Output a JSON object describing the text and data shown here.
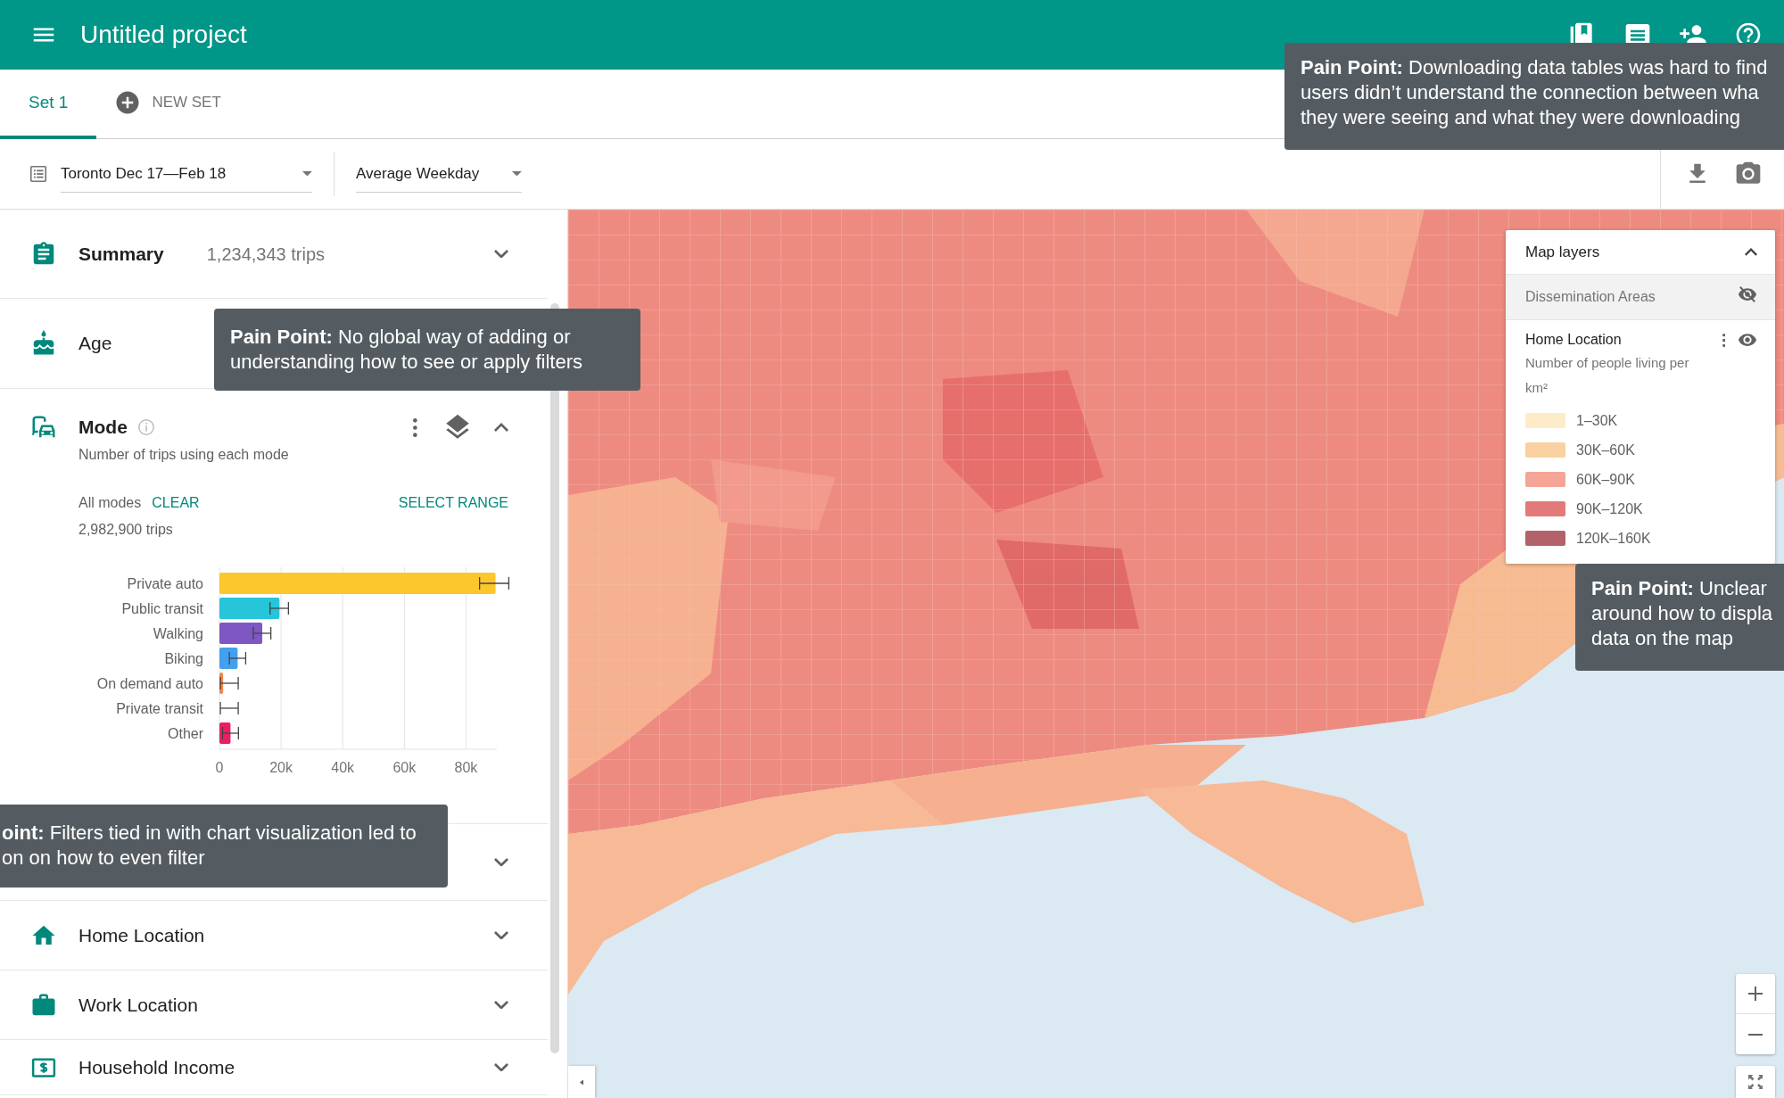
{
  "header": {
    "title": "Untitled project"
  },
  "tabs": [
    {
      "label": "Set 1",
      "selected": true,
      "kind": "tab"
    },
    {
      "label": "NEW SET",
      "selected": false,
      "kind": "add"
    }
  ],
  "filters": [
    {
      "label": "Toronto Dec 17—Feb 18",
      "kind": "dataset"
    },
    {
      "label": "Average Weekday",
      "kind": "plain"
    }
  ],
  "sections": [
    {
      "kind": "summary",
      "title": "Summary",
      "value": "1,234,343 trips",
      "expanded": false
    },
    {
      "kind": "plain",
      "title": "Age"
    },
    {
      "kind": "chart",
      "title": "Mode",
      "subtitle": "Number of trips using each mode",
      "filter_label": "All modes",
      "clear": "CLEAR",
      "select_range": "SELECT RANGE",
      "total": "2,982,900 trips",
      "expanded": true,
      "chart_data": {
        "type": "bar",
        "orientation": "horizontal",
        "categories": [
          "Private auto",
          "Public transit",
          "Walking",
          "Biking",
          "On demand auto",
          "Private transit",
          "Other"
        ],
        "values": [
          89600,
          19500,
          13900,
          5900,
          1200,
          0,
          3600
        ],
        "xlim": [
          0,
          90000
        ],
        "grid": true,
        "xticks": [
          {
            "value": 0,
            "label": "0"
          },
          {
            "value": 20000,
            "label": "20k"
          },
          {
            "value": 40000,
            "label": "40k"
          },
          {
            "value": 60000,
            "label": "60k"
          },
          {
            "value": 80000,
            "label": "80k"
          }
        ]
      }
    },
    {
      "kind": "covered",
      "expanded": false
    },
    {
      "kind": "plain",
      "title": "Home Location",
      "expanded": false
    },
    {
      "kind": "plain",
      "title": "Work Location",
      "expanded": false
    },
    {
      "kind": "plain",
      "title": "Household Income",
      "expanded": false
    }
  ],
  "map_layers": {
    "title": "Map layers",
    "expanded": true,
    "layers": [
      {
        "name": "Dissemination Areas",
        "visible": false
      },
      {
        "name": "Home Location",
        "visible": true,
        "description": "Number of people living per km²",
        "legend": [
          {
            "label": "1–30K",
            "color": "#fdebc9"
          },
          {
            "label": "30K–60K",
            "color": "#f9d0a0"
          },
          {
            "label": "60K–90K",
            "color": "#f4a595"
          },
          {
            "label": "90K–120K",
            "color": "#e27a7a"
          },
          {
            "label": "120K–160K",
            "color": "#b3626b"
          }
        ]
      }
    ]
  },
  "callouts": [
    {
      "lines": [
        "**Pain Point:** Downloading data tables was hard to find",
        "users didn’t understand the connection between wha",
        "they were seeing and what they were downloading"
      ]
    },
    {
      "lines": [
        "**Pain Point:** No global way of adding or",
        "understanding how to see or apply filters"
      ]
    },
    {
      "lines": [
        "**oint:** Filters tied in with chart visualization led to",
        "on on how to even filter"
      ]
    },
    {
      "lines": [
        "**Pain Point:** Unclear",
        "around how to displa",
        "data on the map"
      ]
    }
  ]
}
